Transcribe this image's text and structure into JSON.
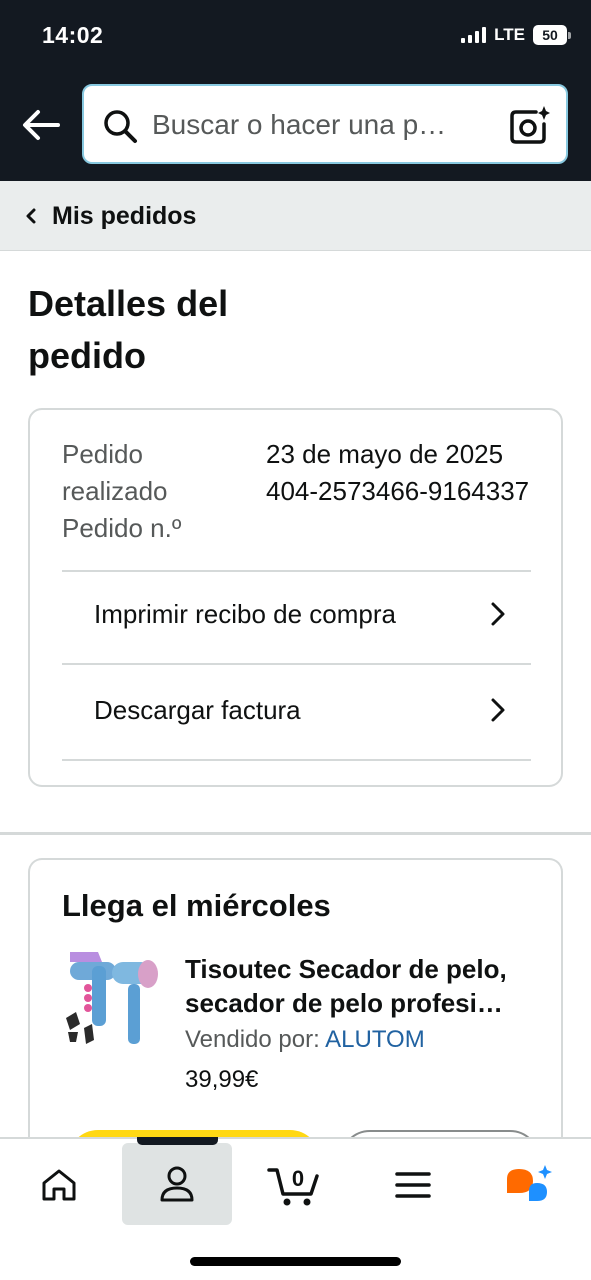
{
  "status_bar": {
    "time": "14:02",
    "network": "LTE",
    "battery": "50"
  },
  "header": {
    "search_placeholder": "Buscar o hacer una p…",
    "icons": [
      "back-arrow-icon",
      "search-icon",
      "camera-sparkle-icon"
    ]
  },
  "breadcrumb": {
    "label": "Mis pedidos"
  },
  "page": {
    "title": "Detalles del pedido"
  },
  "order_info": {
    "labels": "Pedido realizado Pedido n.º",
    "values": "23 de mayo de 2025 404-2573466-9164337",
    "fields": [
      {
        "label": "Pedido realizado",
        "value": "23 de mayo de 2025"
      },
      {
        "label": "Pedido n.º",
        "value": "404-2573466-9164337"
      }
    ]
  },
  "actions": {
    "print_receipt": "Imprimir recibo de compra",
    "download_invoice": "Descargar factura"
  },
  "delivery": {
    "title": "Llega el miércoles",
    "product": {
      "title": "Tisoutec Secador de pelo, secador de pelo profesi…",
      "seller_prefix": "Vendido por: ",
      "seller": "ALUTOM",
      "price": "39,99€"
    }
  },
  "bottom_nav": {
    "cart_count": "0",
    "items": [
      "home-icon",
      "account-icon",
      "cart-icon",
      "menu-icon",
      "rufus-icon"
    ],
    "active": "account-icon"
  },
  "colors": {
    "header_bg": "#131921",
    "link": "#2162a1",
    "primary_button": "#ffd814",
    "rufus_orange": "#ff6a00",
    "rufus_blue": "#1e90ff"
  }
}
